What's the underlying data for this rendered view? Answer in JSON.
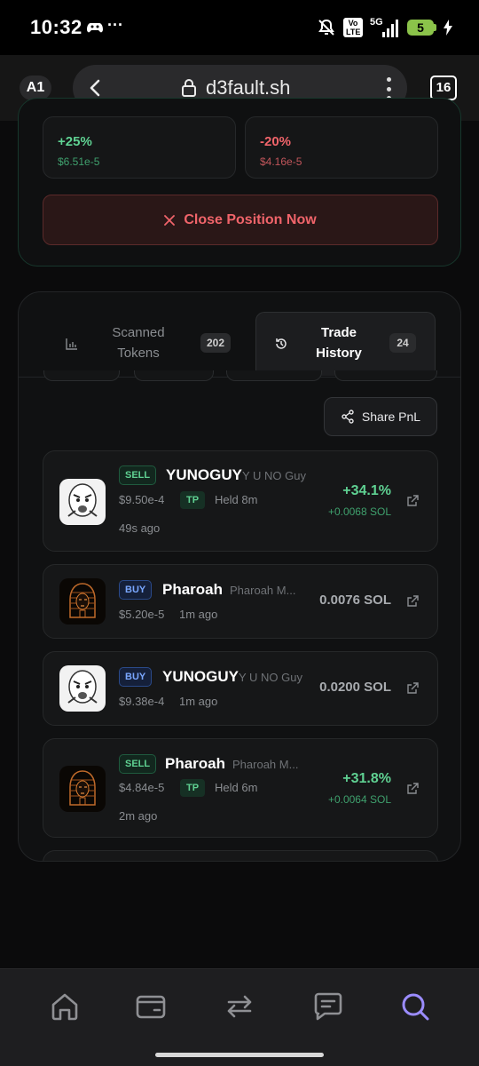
{
  "status_bar": {
    "time": "10:32",
    "dots": "···",
    "volte": "Vo LTE",
    "network": "5G",
    "battery": "5"
  },
  "browser": {
    "profile": "A1",
    "url": "d3fault.sh",
    "tab_count": "16"
  },
  "position": {
    "take_profit": {
      "pct": "+25%",
      "price": "$6.51e-5"
    },
    "stop_loss": {
      "pct": "-20%",
      "price": "$4.16e-5"
    },
    "close_label": "Close Position Now"
  },
  "tabs": [
    {
      "label": "Scanned\nTokens",
      "count": "202",
      "active": false
    },
    {
      "label": "Trade\nHistory",
      "count": "24",
      "active": true
    }
  ],
  "share_label": "Share PnL",
  "trades": [
    {
      "side": "SELL",
      "ticker": "YUNOGUY",
      "name": "Y U NO Guy",
      "price": "$9.50e-4",
      "tp": "TP",
      "held": "Held 8m",
      "age": "49s ago",
      "pnl_pct": "+34.1%",
      "pnl_sol": "+0.0068 SOL",
      "avatar": "meme-face"
    },
    {
      "side": "BUY",
      "ticker": "Pharoah",
      "name": "Pharoah M...",
      "price": "$5.20e-5",
      "age": "1m ago",
      "amount": "0.0076 SOL",
      "avatar": "pharaoh"
    },
    {
      "side": "BUY",
      "ticker": "YUNOGUY",
      "name": "Y U NO Guy",
      "price": "$9.38e-4",
      "age": "1m ago",
      "amount": "0.0200 SOL",
      "avatar": "meme-face"
    },
    {
      "side": "SELL",
      "ticker": "Pharoah",
      "name": "Pharoah M...",
      "price": "$4.84e-5",
      "tp": "TP",
      "held": "Held 6m",
      "age": "2m ago",
      "pnl_pct": "+31.8%",
      "pnl_sol": "+0.0064 SOL",
      "avatar": "pharaoh"
    }
  ],
  "bottom_nav": [
    {
      "icon": "home-icon",
      "active": false
    },
    {
      "icon": "wallet-icon",
      "active": false
    },
    {
      "icon": "swap-icon",
      "active": false
    },
    {
      "icon": "chat-icon",
      "active": false
    },
    {
      "icon": "search-icon",
      "active": true
    }
  ],
  "colors": {
    "accent": "#9b8cff",
    "positive": "#5fd192",
    "negative": "#f0646a"
  }
}
